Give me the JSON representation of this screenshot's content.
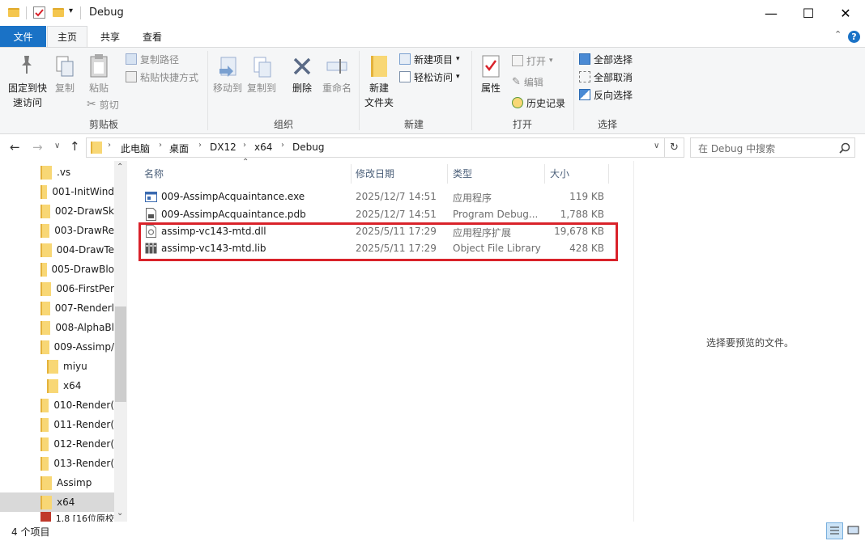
{
  "window": {
    "title": "Debug",
    "controls": {
      "minimize": "—",
      "maximize": "☐",
      "close": "✕"
    }
  },
  "tabs": [
    "文件",
    "主页",
    "共享",
    "查看"
  ],
  "ribbon": {
    "clipboard": {
      "pin": "固定到快",
      "pin2": "速访问",
      "copy": "复制",
      "paste": "粘贴",
      "copy_path": "复制路径",
      "paste_shortcut": "粘贴快捷方式",
      "cut": "剪切",
      "group": "剪贴板"
    },
    "organize": {
      "move_to": "移动到",
      "copy_to": "复制到",
      "delete": "删除",
      "rename": "重命名",
      "group": "组织"
    },
    "new": {
      "new_folder": "新建",
      "new_folder2": "文件夹",
      "new_item": "新建项目",
      "easy_access": "轻松访问",
      "group": "新建"
    },
    "open": {
      "properties": "属性",
      "open": "打开",
      "edit": "编辑",
      "history": "历史记录",
      "group": "打开"
    },
    "select": {
      "select_all": "全部选择",
      "select_none": "全部取消",
      "invert": "反向选择",
      "group": "选择"
    }
  },
  "address": {
    "crumbs": [
      "此电脑",
      "桌面",
      "DX12",
      "x64",
      "Debug"
    ],
    "search_placeholder": "在 Debug 中搜索"
  },
  "nav": [
    ".vs",
    "001-InitWind",
    "002-DrawSk",
    "003-DrawRe",
    "004-DrawTe",
    "005-DrawBlo",
    "006-FirstPer",
    "007-Renderl",
    "008-AlphaBl",
    "009-Assimp/",
    "miyu",
    "x64",
    "010-Render(",
    "011-Render(",
    "012-Render(",
    "013-Render(",
    "Assimp",
    "x64",
    "1.8 [16位原校"
  ],
  "columns": {
    "name": "名称",
    "date": "修改日期",
    "type": "类型",
    "size": "大小"
  },
  "files": [
    {
      "name": "009-AssimpAcquaintance.exe",
      "date": "2025/12/7 14:51",
      "type": "应用程序",
      "size": "119 KB",
      "icon": "exe-icon"
    },
    {
      "name": "009-AssimpAcquaintance.pdb",
      "date": "2025/12/7 14:51",
      "type": "Program Debug...",
      "size": "1,788 KB",
      "icon": "pdb-icon"
    },
    {
      "name": "assimp-vc143-mtd.dll",
      "date": "2025/5/11 17:29",
      "type": "应用程序扩展",
      "size": "19,678 KB",
      "icon": "dll-icon"
    },
    {
      "name": "assimp-vc143-mtd.lib",
      "date": "2025/5/11 17:29",
      "type": "Object File Library",
      "size": "428 KB",
      "icon": "lib-icon"
    }
  ],
  "preview_text": "选择要预览的文件。",
  "status": "4 个项目",
  "colors": {
    "accent": "#1a72c6",
    "highlight": "#d9222a",
    "folder": "#f8d775"
  }
}
